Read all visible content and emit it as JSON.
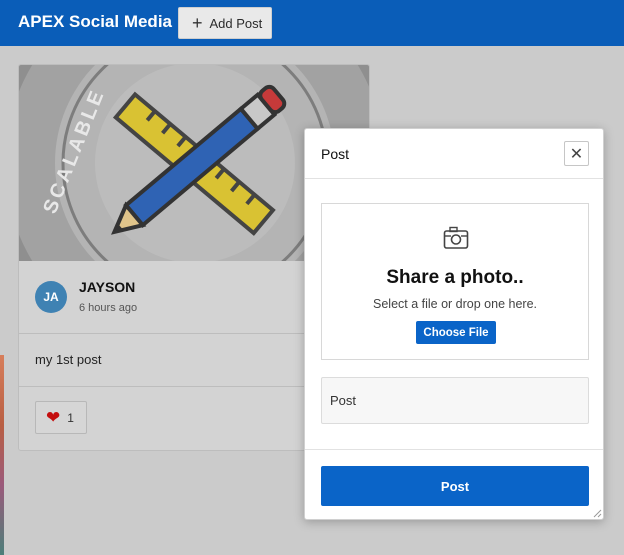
{
  "app": {
    "title": "APEX Social Media",
    "add_post_label": "Add Post"
  },
  "post": {
    "avatar_initials": "JA",
    "author": "JAYSON",
    "time": "6 hours ago",
    "text": "my 1st post",
    "likes": "1",
    "image_text": "SCALABLE"
  },
  "dialog": {
    "title": "Post",
    "dropzone_title": "Share a photo..",
    "dropzone_subtitle": "Select a file or drop one here.",
    "choose_file_label": "Choose File",
    "post_field_placeholder": "Post",
    "submit_label": "Post"
  },
  "colors": {
    "header": "#0a5db8",
    "primary_button": "#0a64c8",
    "like_heart": "#c40e0e",
    "avatar": "#3f82b3"
  },
  "icons": {
    "add": "plus-icon",
    "close": "close-icon",
    "camera": "camera-icon",
    "like": "heart-icon"
  }
}
